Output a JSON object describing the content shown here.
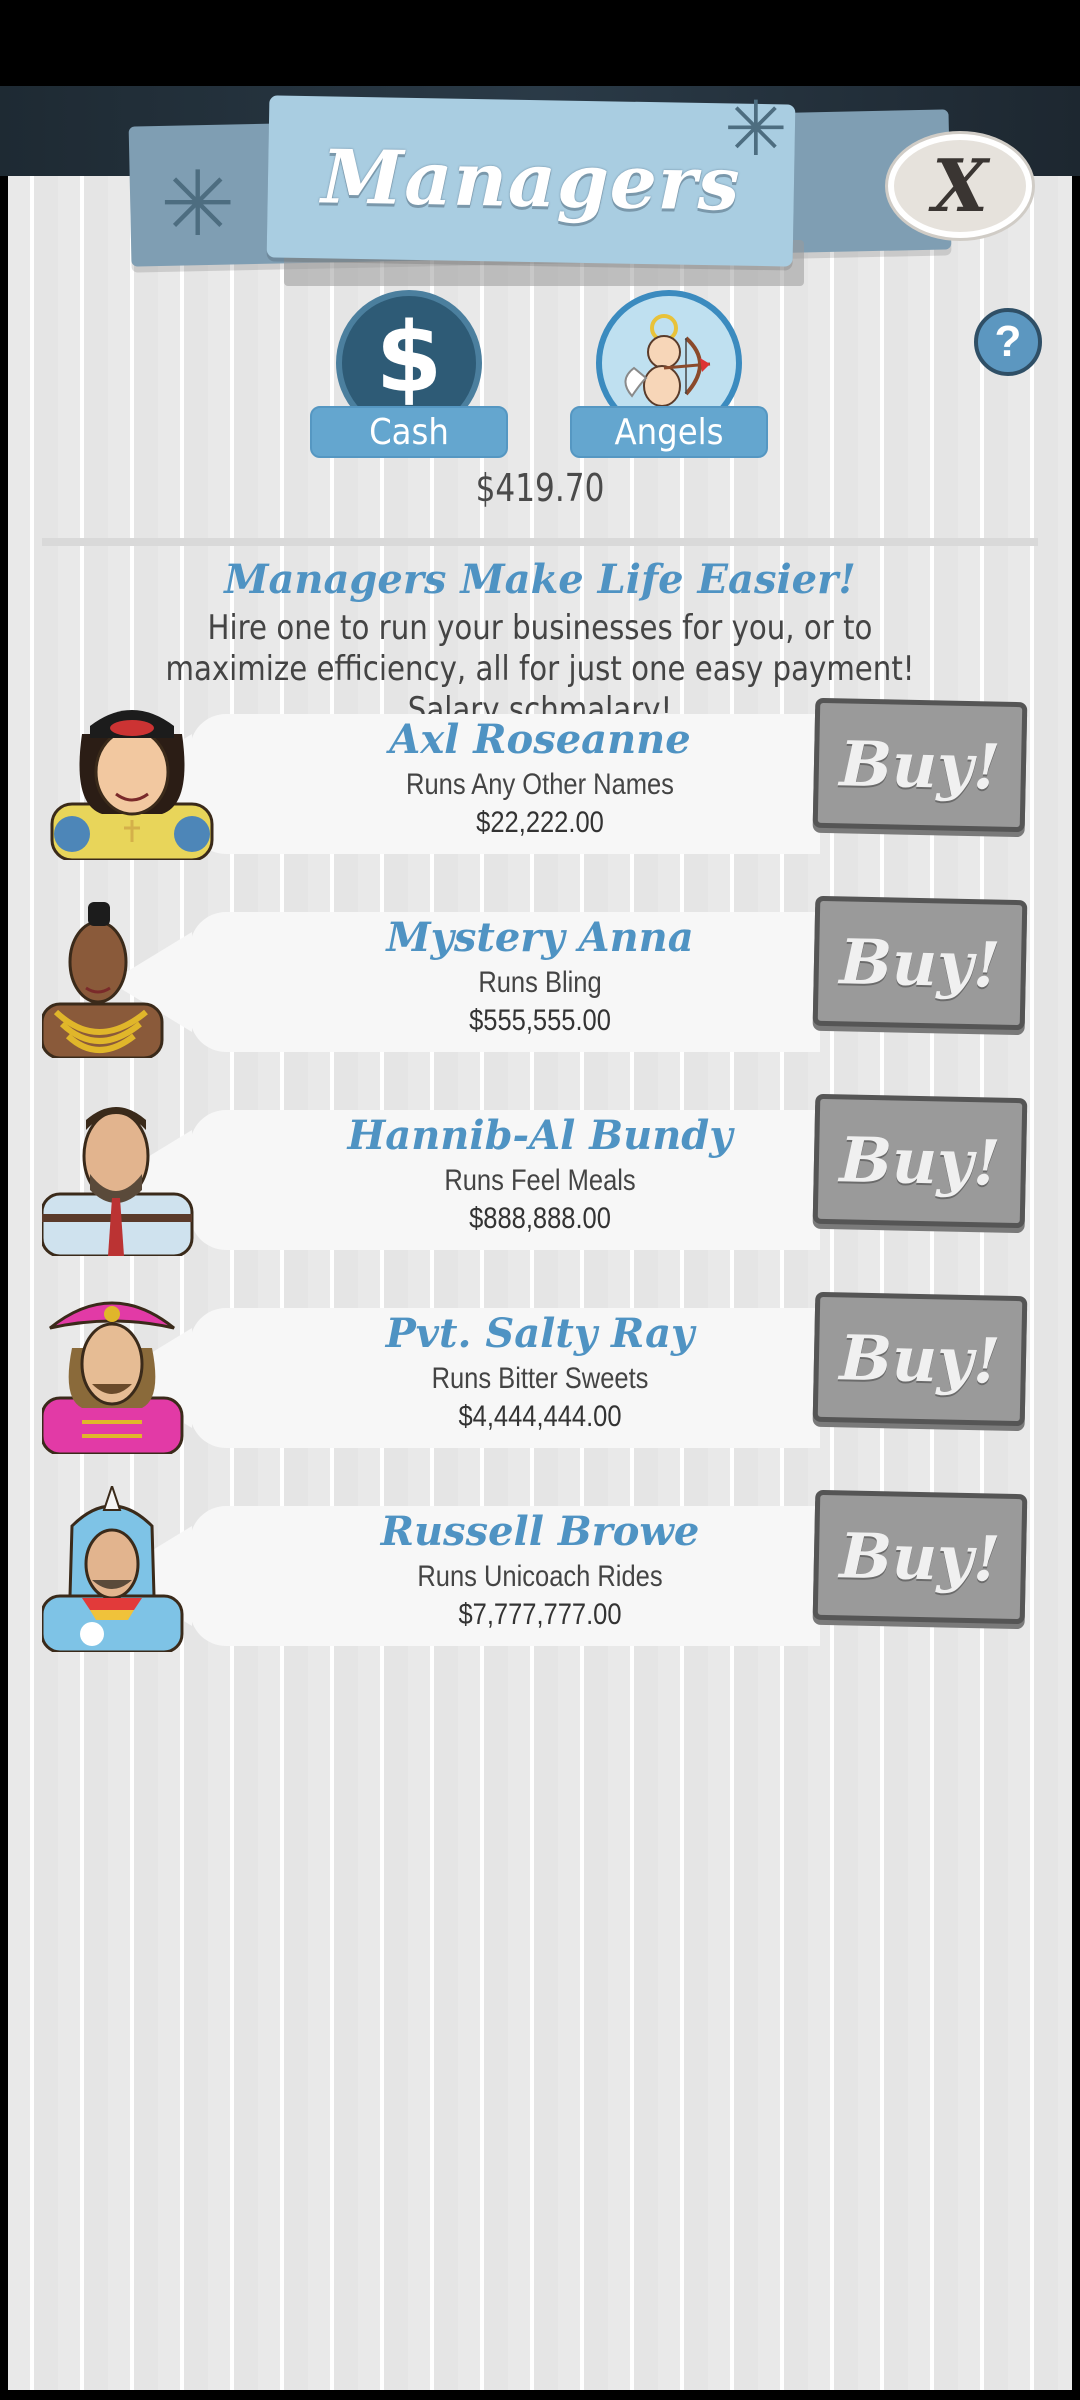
{
  "header": {
    "title": "Managers",
    "close_label": "X"
  },
  "currency_tabs": [
    {
      "label": "Cash",
      "icon": "dollar-icon"
    },
    {
      "label": "Angels",
      "icon": "cupid-icon"
    }
  ],
  "help_label": "?",
  "cash_amount": "$419.70",
  "promo": {
    "title": "Managers Make Life Easier!",
    "body": "Hire one to run your businesses for you, or to maximize efficiency, all for just one easy payment! Salary schmalary!"
  },
  "managers": [
    {
      "name": "Axl Roseanne",
      "runs": "Runs Any Other Names",
      "price": "$22,222.00",
      "buy_label": "Buy!"
    },
    {
      "name": "Mystery Anna",
      "runs": "Runs Bling",
      "price": "$555,555.00",
      "buy_label": "Buy!"
    },
    {
      "name": "Hannib-Al Bundy",
      "runs": "Runs Feel Meals",
      "price": "$888,888.00",
      "buy_label": "Buy!"
    },
    {
      "name": "Pvt. Salty Ray",
      "runs": "Runs Bitter Sweets",
      "price": "$4,444,444.00",
      "buy_label": "Buy!"
    },
    {
      "name": "Russell Browe",
      "runs": "Runs Unicoach Rides",
      "price": "$7,777,777.00",
      "buy_label": "Buy!"
    }
  ],
  "colors": {
    "accent_blue": "#4f93c3",
    "tab_blue": "#64a6cf",
    "buy_gray": "#9a9a9a",
    "panel_bg": "#ececec"
  }
}
